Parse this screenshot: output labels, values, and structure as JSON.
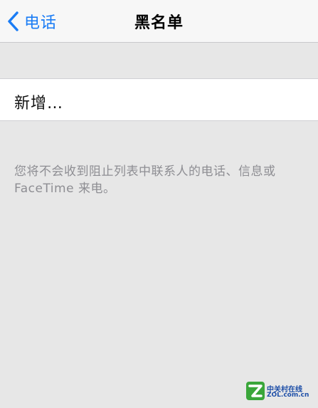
{
  "navbar": {
    "back_label": "电话",
    "title": "黑名单",
    "back_icon": "chevron-left-icon",
    "accent_color": "#1a7cf5"
  },
  "blocklist": {
    "add_label": "新增…",
    "footer_note": "您将不会收到阻止列表中联系人的电话、信息或 FaceTime 来电。"
  },
  "watermark": {
    "line1": "中关村在线",
    "line2": "ZOL.com.cn"
  }
}
